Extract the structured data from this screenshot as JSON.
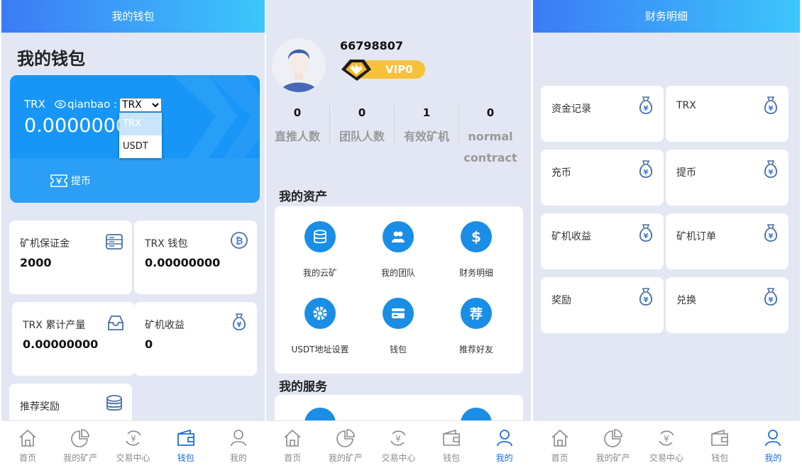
{
  "wallet_panel": {
    "header": "我的钱包",
    "title": "我的钱包",
    "card": {
      "currency": "TRX",
      "address_label": "qianbao :",
      "selected": "TRX",
      "options": [
        "TRX",
        "USDT"
      ],
      "balance": "0.0000000",
      "withdraw": "提币"
    },
    "metrics": [
      {
        "title": "矿机保证金",
        "value": "2000",
        "icon": "storage-list-icon"
      },
      {
        "title": "TRX 钱包",
        "value": "0.00000000",
        "icon": "bitcoin-icon"
      },
      {
        "title": "TRX 累计产量",
        "value": "0.00000000",
        "icon": "inbox-tray-icon"
      },
      {
        "title": "矿机收益",
        "value": "0",
        "icon": "money-bag-icon"
      },
      {
        "title": "推荐奖励",
        "value": "",
        "icon": "coin-stack-icon"
      }
    ]
  },
  "profile_panel": {
    "user_id": "66798807",
    "vip": "VIP0",
    "stats": [
      {
        "value": "0",
        "label": "直推人数"
      },
      {
        "value": "0",
        "label": "团队人数"
      },
      {
        "value": "1",
        "label": "有效矿机"
      },
      {
        "value": "0",
        "label": "normal contract"
      }
    ],
    "assets_title": "我的资产",
    "assets": [
      {
        "label": "我的云矿",
        "icon": "database-icon"
      },
      {
        "label": "我的团队",
        "icon": "team-icon"
      },
      {
        "label": "财务明细",
        "icon": "dollar-icon"
      },
      {
        "label": "USDT地址设置",
        "icon": "gear-icon"
      },
      {
        "label": "钱包",
        "icon": "card-icon"
      },
      {
        "label": "推荐好友",
        "icon": "recommend-icon"
      }
    ],
    "services_title": "我的服务",
    "tab_labels_note": ""
  },
  "finance_panel": {
    "header": "财务明细",
    "items": [
      "资金记录",
      "TRX",
      "充币",
      "提币",
      "矿机收益",
      "矿机订单",
      "奖励",
      "兑换"
    ]
  },
  "tabbar": {
    "tabs": [
      "首页",
      "我的矿产",
      "交易中心",
      "钱包",
      "我的"
    ]
  },
  "colors": {
    "accent": "#1a6fe0",
    "card_blue": "#1796f7",
    "header_from": "#3b7bf5",
    "header_to": "#3cc7fb",
    "vip_gold": "#f7c23a"
  }
}
